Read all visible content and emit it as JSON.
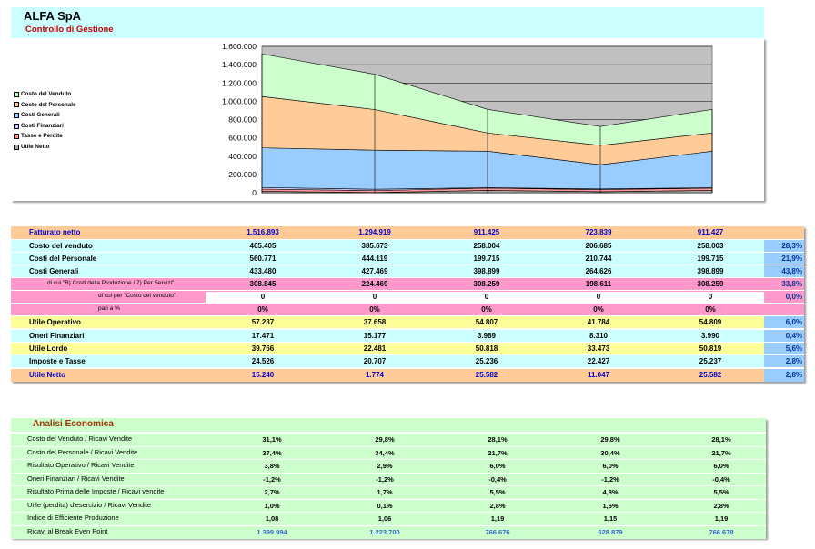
{
  "header": {
    "title": "ALFA SpA",
    "subtitle": "Controllo di Gestione"
  },
  "chart_data": {
    "type": "area",
    "stacked": true,
    "x": [
      1,
      2,
      3,
      4,
      5
    ],
    "ylim": [
      0,
      1600000
    ],
    "yticks": [
      "1.600.000",
      "1.400.000",
      "1.200.000",
      "1.000.000",
      "800.000",
      "600.000",
      "400.000",
      "200.000",
      "0"
    ],
    "legend_position": "left",
    "series": [
      {
        "name": "Utile Netto",
        "color": "#aaaaaa",
        "values": [
          15240,
          1774,
          25582,
          11047,
          25582
        ]
      },
      {
        "name": "Tasse e Perdite",
        "color": "#ff9999",
        "values": [
          24526,
          20707,
          25236,
          22427,
          25237
        ]
      },
      {
        "name": "Costi Finanziari",
        "color": "#ccccff",
        "values": [
          17471,
          15177,
          3989,
          8310,
          3990
        ]
      },
      {
        "name": "Costi Generali",
        "color": "#99ccff",
        "values": [
          433480,
          427469,
          398899,
          264626,
          398899
        ]
      },
      {
        "name": "Costo del Personale",
        "color": "#ffcc99",
        "values": [
          560771,
          444119,
          199715,
          210744,
          199715
        ]
      },
      {
        "name": "Costo del Venduto",
        "color": "#ccffcc",
        "values": [
          465405,
          385673,
          258004,
          206685,
          258003
        ]
      }
    ],
    "background_color": "#c0c0c0",
    "legend_order": [
      "Costo del Venduto",
      "Costo del Personale",
      "Costi Generali",
      "Costi Finanziari",
      "Tasse e Perdite",
      "Utile Netto"
    ]
  },
  "table": {
    "rows": [
      {
        "label": "Fatturato netto",
        "values": [
          "1.516.893",
          "1.294.919",
          "911.425",
          "723.839",
          "911.427"
        ],
        "pct": "",
        "bg": "#ffcc99",
        "color": "#0000cc",
        "indent": "normal"
      },
      {
        "label": "Costo del venduto",
        "values": [
          "465.405",
          "385.673",
          "258.004",
          "206.685",
          "258.003"
        ],
        "pct": "28,3%",
        "bg": "#ccffff",
        "color": "#000000",
        "indent": "normal"
      },
      {
        "label": "Costi del Personale",
        "values": [
          "560.771",
          "444.119",
          "199.715",
          "210.744",
          "199.715"
        ],
        "pct": "21,9%",
        "bg": "#ccffff",
        "color": "#000000",
        "indent": "normal"
      },
      {
        "label": "Costi Generali",
        "values": [
          "433.480",
          "427.469",
          "398.899",
          "264.626",
          "398.899"
        ],
        "pct": "43,8%",
        "bg": "#ccffff",
        "color": "#000000",
        "indent": "normal"
      },
      {
        "label": "di cui \"B) Costi della Produzione / 7) Per Servizi\"",
        "values": [
          "308.845",
          "224.469",
          "308.259",
          "198.611",
          "308.259"
        ],
        "pct": "33,8%",
        "bg": "#ff99cc",
        "color": "#000000",
        "indent": "sub"
      },
      {
        "label": "di cui per \"Costo del venduto\"",
        "values": [
          "0",
          "0",
          "0",
          "0",
          "0"
        ],
        "pct": "0,0%",
        "bg": "#ff99cc",
        "color": "#000000",
        "indent": "subsub",
        "white_values": true
      },
      {
        "label": "pari a %",
        "values": [
          "0%",
          "0%",
          "0%",
          "0%",
          "0%"
        ],
        "pct": "",
        "bg": "#ff99cc",
        "color": "#000000",
        "indent": "sub2"
      },
      {
        "label": "Utile Operativo",
        "values": [
          "57.237",
          "37.658",
          "54.807",
          "41.784",
          "54.809"
        ],
        "pct": "6,0%",
        "bg": "#ffff99",
        "color": "#000000",
        "indent": "normal"
      },
      {
        "label": "Oneri Finanziari",
        "values": [
          "17.471",
          "15.177",
          "3.989",
          "8.310",
          "3.990"
        ],
        "pct": "0,4%",
        "bg": "#ccffff",
        "color": "#000000",
        "indent": "normal"
      },
      {
        "label": "Utile Lordo",
        "values": [
          "39.766",
          "22.481",
          "50.818",
          "33.473",
          "50.819"
        ],
        "pct": "5,6%",
        "bg": "#ffff99",
        "color": "#000000",
        "indent": "normal"
      },
      {
        "label": "Imposte e Tasse",
        "values": [
          "24.526",
          "20.707",
          "25.236",
          "22.427",
          "25.237"
        ],
        "pct": "2,8%",
        "bg": "#ccffff",
        "color": "#000000",
        "indent": "normal"
      },
      {
        "label": "Utile Netto",
        "values": [
          "15.240",
          "1.774",
          "25.582",
          "11.047",
          "25.582"
        ],
        "pct": "2,8%",
        "bg": "#ffcc99",
        "color": "#0000cc",
        "indent": "normal"
      }
    ]
  },
  "analysis": {
    "title": "Analisi Economica",
    "rows": [
      {
        "label": "Costo del Venduto / Ricavi Vendite",
        "values": [
          "31,1%",
          "29,8%",
          "28,1%",
          "29,8%",
          "28,1%"
        ]
      },
      {
        "label": "Costo del Personale / Ricavi Vendite",
        "values": [
          "37,4%",
          "34,4%",
          "21,7%",
          "30,4%",
          "21,7%"
        ]
      },
      {
        "label": "Risultato Operativo / Ricavi Vendite",
        "values": [
          "3,8%",
          "2,9%",
          "6,0%",
          "6,0%",
          "6,0%"
        ]
      },
      {
        "label": "Oneri Finanziari / Ricavi Vendite",
        "values": [
          "-1,2%",
          "-1,2%",
          "-0,4%",
          "-1,2%",
          "-0,4%"
        ]
      },
      {
        "label": "Risultato Prima delle Imposte / Ricavi vendite",
        "values": [
          "2,7%",
          "1,7%",
          "5,5%",
          "4,8%",
          "5,5%"
        ]
      },
      {
        "label": "Utile (perdita) d'esercizio / Ricavi Vendite",
        "values": [
          "1,0%",
          "0,1%",
          "2,8%",
          "1,6%",
          "2,8%"
        ]
      },
      {
        "label": "Indice di Efficiente Produzione",
        "values": [
          "1,08",
          "1,06",
          "1,19",
          "1,15",
          "1,19"
        ]
      },
      {
        "label": "Ricavi al Break Even Point",
        "values": [
          "1.399.994",
          "1.223.700",
          "766.676",
          "628.879",
          "766.678"
        ],
        "blue": true
      }
    ]
  }
}
